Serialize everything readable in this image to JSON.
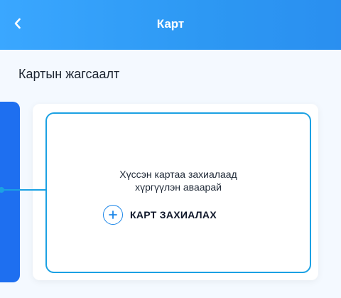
{
  "header": {
    "title": "Карт",
    "back_icon": "chevron-left-icon"
  },
  "section": {
    "title": "Картын жагсаалт"
  },
  "card_panel": {
    "message_line1": "Хүссэн картаа захиалаад",
    "message_line2": "хүргүүлэн аваарай",
    "order_button_label": "КАРТ ЗАХИАЛАХ",
    "order_icon": "plus-icon"
  },
  "colors": {
    "header_gradient_start": "#3aa7ff",
    "header_gradient_end": "#2a8ff0",
    "accent": "#1ba1e3",
    "prev_card": "#1e6ff0",
    "text_dark": "#0f172a",
    "white": "#ffffff"
  }
}
